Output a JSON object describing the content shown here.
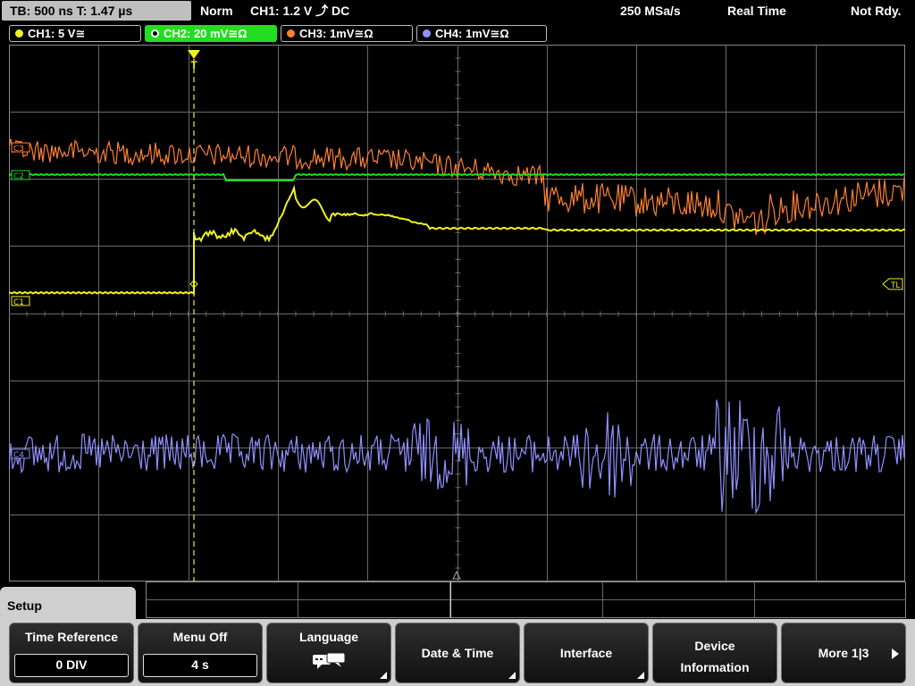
{
  "status_bar": {
    "timebase": "TB: 500 ns   T: 1.47 µs",
    "trigger_mode": "Norm",
    "trigger_info": "CH1: 1.2 V ⤴ DC",
    "sample_rate": "250 MSa/s",
    "acquisition_mode": "Real Time",
    "ready_state": "Not Rdy."
  },
  "channels": [
    {
      "label": "CH1: 5 V≅",
      "color": "#f0f020"
    },
    {
      "label": "CH2: 20 mV≅Ω",
      "color": "#22dd22"
    },
    {
      "label": "CH3: 1mV≅Ω",
      "color": "#ff8030"
    },
    {
      "label": "CH4: 1mV≅Ω",
      "color": "#9090ff"
    }
  ],
  "waveform_markers": {
    "ch1": "C1",
    "ch2": "C2",
    "ch3": "C3",
    "ch4": "C4",
    "trigger_level": "TL",
    "trigger_position": "T"
  },
  "colors": {
    "ch1": "#f0f020",
    "ch2": "#22dd22",
    "ch3": "#ff8030",
    "ch4": "#9090ff",
    "grid": "#6a6a6a",
    "trigger_line": "#f0f020"
  },
  "menu": {
    "title": "Setup",
    "softkeys": [
      {
        "label": "Time Reference",
        "value": "0 DIV",
        "icon": null
      },
      {
        "label": "Menu Off",
        "value": "4 s",
        "icon": null
      },
      {
        "label": "Language",
        "value": null,
        "icon": "speech-bubbles-icon"
      },
      {
        "label": "Date & Time",
        "value": null,
        "icon": null
      },
      {
        "label": "Interface",
        "value": null,
        "icon": null
      },
      {
        "label": "Device\nInformation",
        "value": null,
        "icon": null
      },
      {
        "label": "More 1|3",
        "value": null,
        "icon": "arrow-right-icon"
      }
    ]
  }
}
